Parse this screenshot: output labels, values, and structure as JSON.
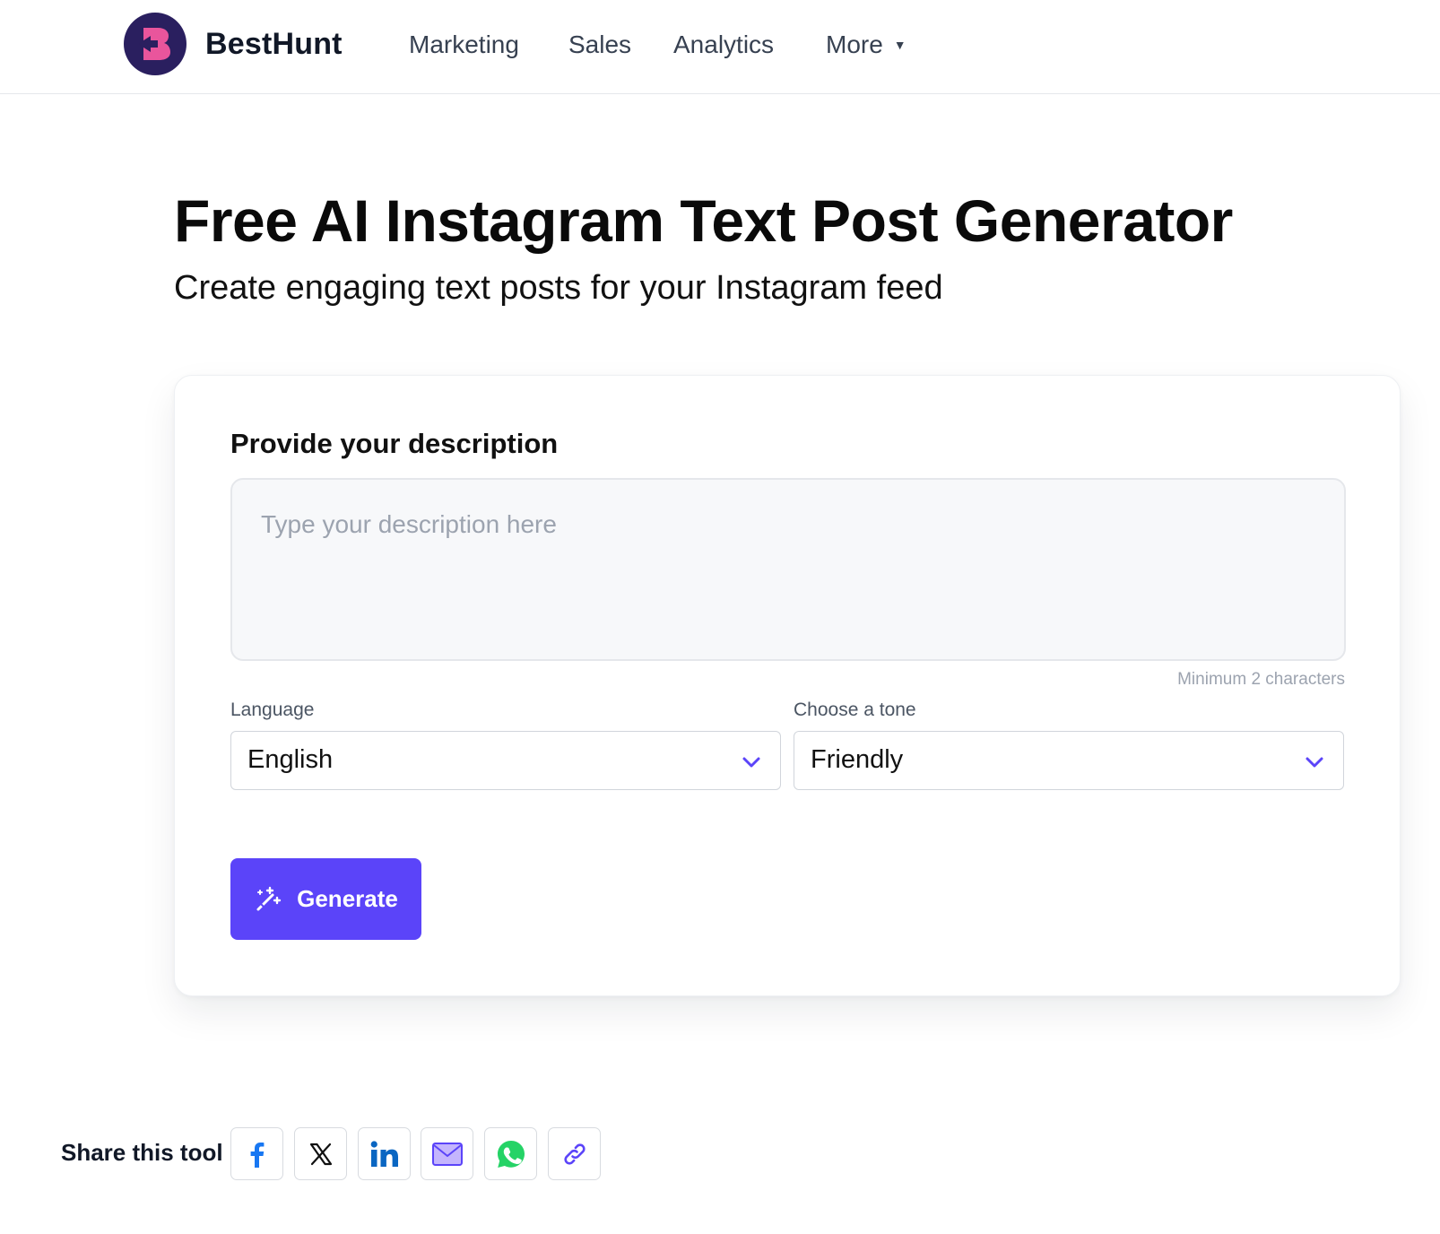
{
  "header": {
    "brand": "BestHunt",
    "logo_icon": "besthunt-logo-icon",
    "nav": [
      {
        "label": "Marketing"
      },
      {
        "label": "Sales"
      },
      {
        "label": "Analytics"
      },
      {
        "label": "More"
      }
    ],
    "more_caret": "▼"
  },
  "hero": {
    "title": "Free AI Instagram Text Post Generator",
    "subtitle": "Create engaging text posts for your Instagram feed"
  },
  "form": {
    "heading": "Provide your description",
    "description": {
      "value": "",
      "placeholder": "Type your description here",
      "helper": "Minimum 2 characters"
    },
    "language": {
      "label": "Language",
      "value": "English"
    },
    "tone": {
      "label": "Choose a tone",
      "value": "Friendly"
    },
    "generate_label": "Generate"
  },
  "share": {
    "label": "Share this tool",
    "buttons": [
      {
        "icon": "facebook-icon"
      },
      {
        "icon": "x-icon"
      },
      {
        "icon": "linkedin-icon"
      },
      {
        "icon": "email-icon"
      },
      {
        "icon": "whatsapp-icon"
      },
      {
        "icon": "link-icon"
      }
    ]
  },
  "colors": {
    "accent": "#5b44f9",
    "logo_bg": "#2a1f5f",
    "logo_mark": "#e9559c",
    "facebook": "#1877f2",
    "linkedin": "#0a66c2",
    "whatsapp": "#25d366"
  }
}
